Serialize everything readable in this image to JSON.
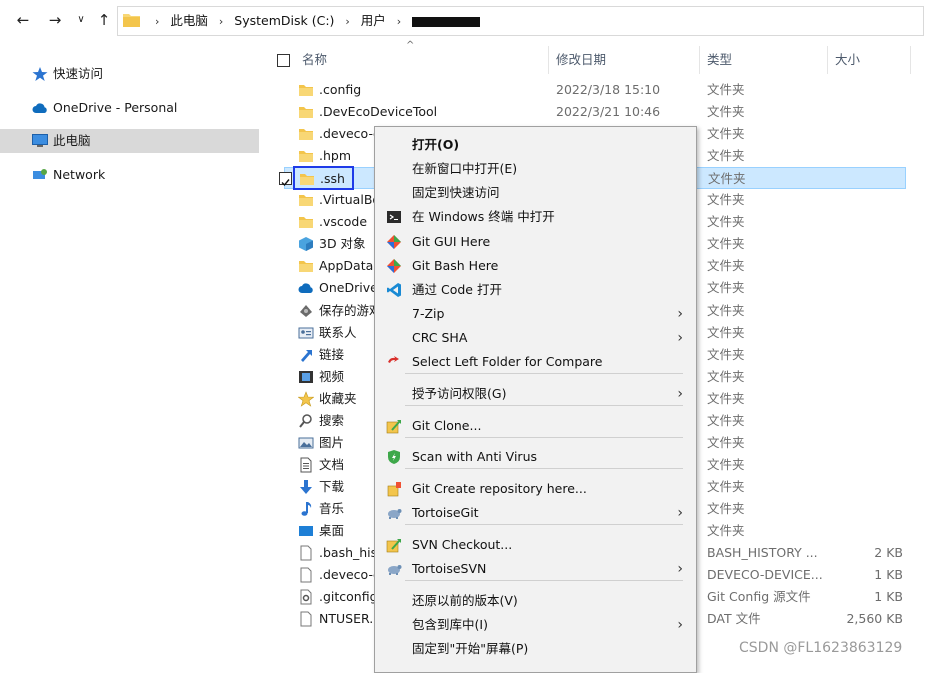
{
  "address": {
    "crumbs": [
      "此电脑",
      "SystemDisk (C:)",
      "用户"
    ]
  },
  "nav": [
    {
      "label": "快速访问",
      "icon": "star-icon"
    },
    {
      "label": "OneDrive - Personal",
      "icon": "cloud-icon"
    },
    {
      "label": "此电脑",
      "icon": "computer-icon",
      "selected": true
    },
    {
      "label": "Network",
      "icon": "network-icon"
    }
  ],
  "columns": {
    "name": "名称",
    "date": "修改日期",
    "type": "类型",
    "size": "大小"
  },
  "files": [
    {
      "name": ".config",
      "date": "2022/3/18 15:10",
      "type": "文件夹",
      "size": ""
    },
    {
      "name": ".DevEcoDeviceTool",
      "date": "2022/3/21 10:46",
      "type": "文件夹",
      "size": ""
    },
    {
      "name": ".deveco-d",
      "date": "",
      "type": "文件夹",
      "size": ""
    },
    {
      "name": ".hpm",
      "date": "",
      "type": "文件夹",
      "size": ""
    },
    {
      "name": ".ssh",
      "date": "",
      "type": "文件夹",
      "size": "",
      "selected": true
    },
    {
      "name": ".VirtualBo",
      "date": "",
      "type": "文件夹",
      "size": ""
    },
    {
      "name": ".vscode",
      "date": "",
      "type": "文件夹",
      "size": ""
    },
    {
      "name": "3D 对象",
      "date": "",
      "type": "文件夹",
      "size": ""
    },
    {
      "name": "AppData",
      "date": "",
      "type": "文件夹",
      "size": ""
    },
    {
      "name": "OneDrive",
      "date": "",
      "type": "文件夹",
      "size": ""
    },
    {
      "name": "保存的游戏",
      "date": "",
      "type": "文件夹",
      "size": ""
    },
    {
      "name": "联系人",
      "date": "",
      "type": "文件夹",
      "size": ""
    },
    {
      "name": "链接",
      "date": "",
      "type": "文件夹",
      "size": ""
    },
    {
      "name": "视频",
      "date": "",
      "type": "文件夹",
      "size": ""
    },
    {
      "name": "收藏夹",
      "date": "",
      "type": "文件夹",
      "size": ""
    },
    {
      "name": "搜索",
      "date": "",
      "type": "文件夹",
      "size": ""
    },
    {
      "name": "图片",
      "date": "",
      "type": "文件夹",
      "size": ""
    },
    {
      "name": "文档",
      "date": "",
      "type": "文件夹",
      "size": ""
    },
    {
      "name": "下载",
      "date": "",
      "type": "文件夹",
      "size": ""
    },
    {
      "name": "音乐",
      "date": "",
      "type": "文件夹",
      "size": ""
    },
    {
      "name": "桌面",
      "date": "",
      "type": "文件夹",
      "size": ""
    },
    {
      "name": ".bash_his",
      "date": "",
      "type": "BASH_HISTORY ...",
      "size": "2 KB"
    },
    {
      "name": ".deveco-c",
      "date": "",
      "type": "DEVECO-DEVICE...",
      "size": "1 KB"
    },
    {
      "name": ".gitconfig",
      "date": "",
      "type": "Git Config 源文件",
      "size": "1 KB"
    },
    {
      "name": "NTUSER.",
      "date": "",
      "type": "DAT 文件",
      "size": "2,560 KB"
    }
  ],
  "menu": [
    {
      "label": "打开(O)",
      "bold": true,
      "icon": ""
    },
    {
      "label": "在新窗口中打开(E)",
      "icon": ""
    },
    {
      "label": "固定到快速访问",
      "icon": ""
    },
    {
      "label": "在 Windows 终端 中打开",
      "icon": "terminal-icon"
    },
    {
      "label": "Git GUI Here",
      "icon": "git-icon"
    },
    {
      "label": "Git Bash Here",
      "icon": "git-icon"
    },
    {
      "label": "通过 Code 打开",
      "icon": "vscode-icon"
    },
    {
      "label": "7-Zip",
      "icon": "",
      "submenu": true
    },
    {
      "label": "CRC SHA",
      "icon": "",
      "submenu": true
    },
    {
      "label": "Select Left Folder for Compare",
      "icon": "compare-icon"
    },
    {
      "label": "授予访问权限(G)",
      "icon": "",
      "submenu": true
    },
    {
      "label": "Git Clone...",
      "icon": "git-clone-icon"
    },
    {
      "label": "Scan with Anti Virus",
      "icon": "shield-icon"
    },
    {
      "label": "Git Create repository here...",
      "icon": "git-repo-icon"
    },
    {
      "label": "TortoiseGit",
      "icon": "tortoise-icon",
      "submenu": true
    },
    {
      "label": "SVN Checkout...",
      "icon": "svn-checkout-icon"
    },
    {
      "label": "TortoiseSVN",
      "icon": "tortoise-icon",
      "submenu": true
    },
    {
      "label": "还原以前的版本(V)",
      "icon": ""
    },
    {
      "label": "包含到库中(I)",
      "icon": "",
      "submenu": true
    },
    {
      "label": "固定到\"开始\"屏幕(P)",
      "icon": ""
    }
  ],
  "watermark": "CSDN @FL1623863129"
}
